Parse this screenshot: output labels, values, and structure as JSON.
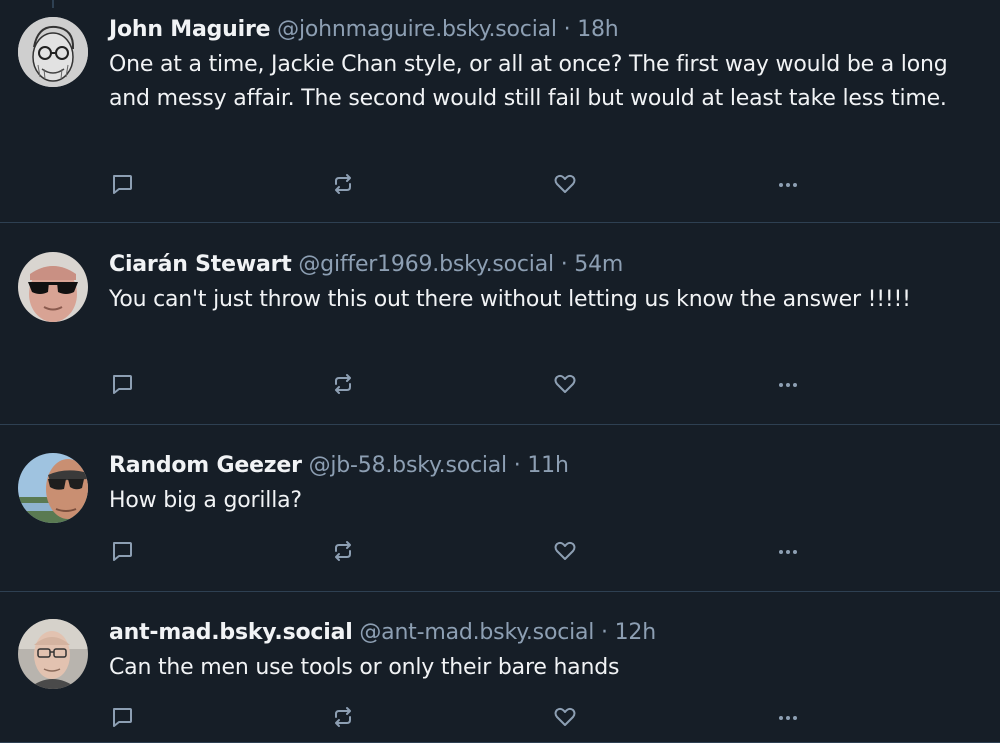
{
  "posts": [
    {
      "name": "John Maguire",
      "handle": "@johnmaguire.bsky.social",
      "separator": "·",
      "time": "18h",
      "text": "One at a time, Jackie Chan style, or all at once? The first way would be a long and messy affair. The second would still fail but would at least take less time.",
      "avatar": "avatar-cartoon-glasses"
    },
    {
      "name": "Ciarán Stewart",
      "handle": "@giffer1969.bsky.social",
      "separator": "·",
      "time": "54m",
      "text": "You can't just throw this out there without letting us know the answer !!!!!",
      "avatar": "avatar-sunglasses-man"
    },
    {
      "name": "Random Geezer",
      "handle": "@jb-58.bsky.social",
      "separator": "·",
      "time": "11h",
      "text": "How big a gorilla?",
      "avatar": "avatar-selfie-lake"
    },
    {
      "name": "ant-mad.bsky.social",
      "handle": "@ant-mad.bsky.social",
      "separator": "·",
      "time": "12h",
      "text": "Can the men use tools or only their bare hands",
      "avatar": "avatar-glasses-man"
    }
  ],
  "icons": {
    "reply": "reply-icon",
    "repost": "repost-icon",
    "like": "like-icon",
    "more": "more-options-icon"
  },
  "colors": {
    "background": "#161e27",
    "text": "#f1f3f5",
    "muted": "#8d9fb3",
    "border": "#2e4052"
  }
}
